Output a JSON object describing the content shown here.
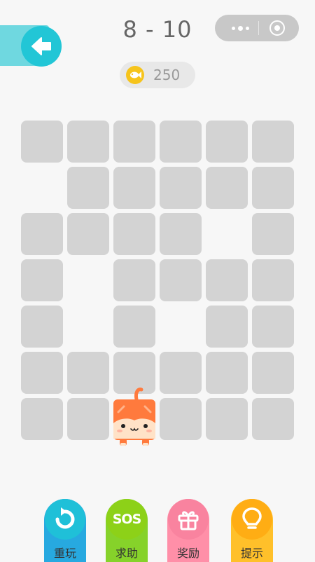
{
  "header": {
    "level": "8 - 10",
    "coins": "250"
  },
  "board": {
    "rows": 7,
    "cols": 6,
    "tiles": [
      [
        1,
        1,
        1,
        1,
        1,
        1
      ],
      [
        0,
        1,
        1,
        1,
        1,
        1
      ],
      [
        1,
        1,
        1,
        1,
        0,
        1
      ],
      [
        1,
        0,
        1,
        1,
        1,
        1
      ],
      [
        1,
        0,
        1,
        0,
        1,
        1
      ],
      [
        1,
        1,
        1,
        1,
        1,
        1
      ],
      [
        1,
        1,
        0,
        1,
        1,
        1
      ]
    ],
    "cat_position": {
      "row": 6,
      "col": 2
    }
  },
  "actions": [
    {
      "label": "重玩",
      "icon": "replay-icon",
      "color": "#1fc0d8",
      "tail": "#27a9e0"
    },
    {
      "label": "求助",
      "icon": "sos-icon",
      "sos": "SOS",
      "color": "#8dd118",
      "tail": "#86d22a"
    },
    {
      "label": "奖励",
      "icon": "gift-icon",
      "color": "#f9839f",
      "tail": "#ff8fa8"
    },
    {
      "label": "提示",
      "icon": "bulb-icon",
      "color": "#ffad14",
      "tail": "#ffc02a"
    }
  ],
  "colors": {
    "tile": "#d3d3d3",
    "background": "#f7f7f7",
    "back_button": "#22c6d6",
    "cat": "#ff7a3d"
  }
}
